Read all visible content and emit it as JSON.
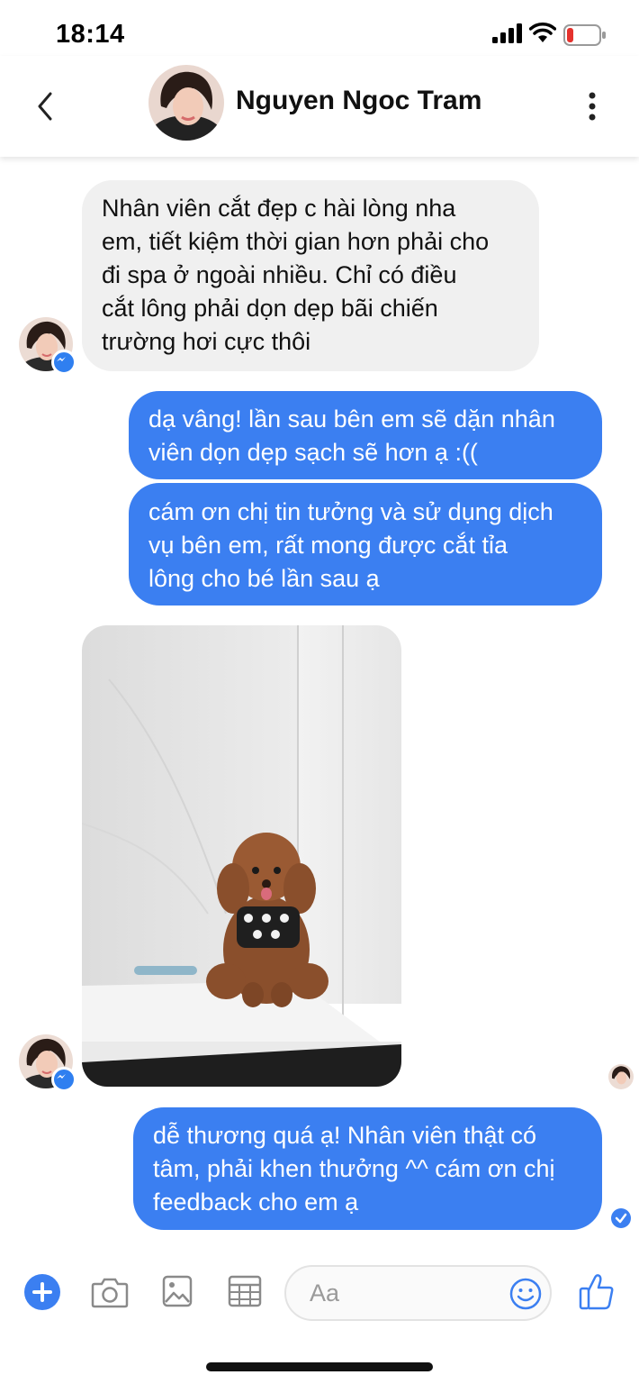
{
  "status_bar": {
    "time": "18:14"
  },
  "header": {
    "contact_name": "Nguyen Ngoc Tram"
  },
  "messages": [
    {
      "from": "contact",
      "lines": [
        "Nhân viên cắt đẹp c hài lòng nha",
        "em, tiết kiệm thời gian hơn phải cho",
        "đi spa ở ngoài nhiều. Chỉ có điều",
        "cắt lông phải dọn dẹp bãi chiến",
        "trường hơi cực thôi"
      ]
    },
    {
      "from": "me",
      "lines": [
        "dạ vâng! lần sau bên em sẽ dặn nhân",
        "viên dọn dẹp sạch sẽ hơn ạ :(("
      ]
    },
    {
      "from": "me",
      "lines": [
        "cám ơn chị tin tưởng và sử dụng dịch",
        "vụ bên em, rất mong được cắt tỉa",
        "lông cho bé lần sau ạ"
      ]
    },
    {
      "from": "me",
      "lines": [
        "dễ thương quá ạ! Nhân viên thật có",
        "tâm, phải khen thưởng ^^ cám ơn chị",
        "feedback cho em ạ"
      ]
    }
  ],
  "composer": {
    "placeholder": "Aa"
  },
  "colors": {
    "outgoing": "#3b7ff1",
    "incoming": "#f0f0f0"
  }
}
